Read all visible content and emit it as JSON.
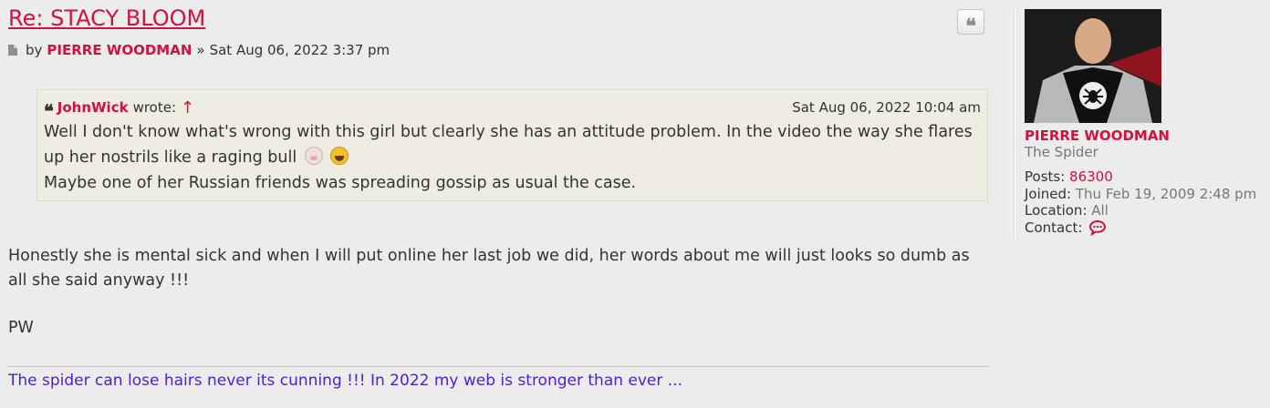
{
  "post": {
    "title": "Re: STACY BLOOM",
    "by_label": "by",
    "author": "PIERRE WOODMAN",
    "separator": "»",
    "date": "Sat Aug 06, 2022 3:37 pm",
    "quote_button_glyph": "❝",
    "quote": {
      "author": "JohnWick",
      "wrote_label": "wrote:",
      "arrow": "↑",
      "date": "Sat Aug 06, 2022 10:04 am",
      "line1": "Well I don't know what's wrong with this girl but clearly she has an attitude problem. In the video the way she flares up her nostrils like a raging bull",
      "line2": "Maybe one of her Russian friends was spreading gossip as usual the case."
    },
    "body": "Honestly she is mental sick and when I will put online her last job we did, her words about me will just looks so dumb as all she said anyway !!!",
    "signoff": "PW",
    "signature": "The spider can lose hairs never its cunning !!! In 2022 my web is stronger than ever ..."
  },
  "profile": {
    "name": "PIERRE WOODMAN",
    "rank": "The Spider",
    "posts_label": "Posts:",
    "posts_value": "86300",
    "joined_label": "Joined:",
    "joined_value": "Thu Feb 19, 2009 2:48 pm",
    "location_label": "Location:",
    "location_value": "All",
    "contact_label": "Contact:"
  },
  "icons": {
    "post_icon": "document-icon",
    "quote_icon": "quote-icon",
    "contact_icon": "speech-bubble-icon",
    "emoji1": "cow-emoji-icon",
    "emoji2": "laughing-emoji-icon"
  },
  "colors": {
    "accent": "#d31141",
    "signature": "#4a1fd6",
    "background": "#ececec",
    "quote_background": "#efede1"
  }
}
